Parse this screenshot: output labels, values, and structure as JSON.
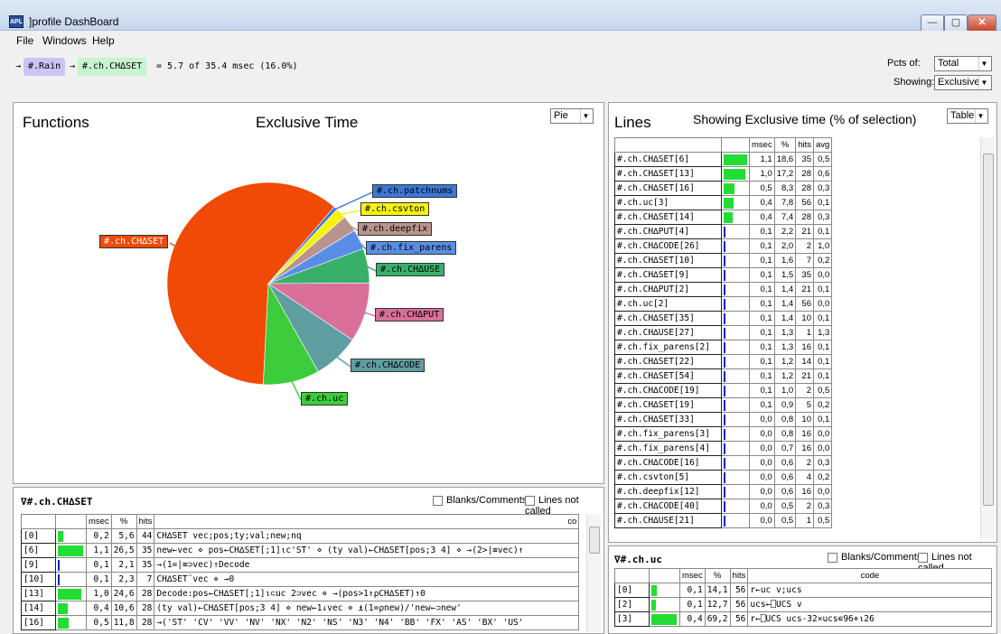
{
  "window": {
    "title": "]profile DashBoard",
    "icon_text": "APL",
    "min": "—",
    "max": "▢",
    "close": "✕"
  },
  "menu": [
    "File",
    "Windows",
    "Help"
  ],
  "selection": {
    "arrow1": "→",
    "tag1": "#.Rain",
    "arrow2": "→",
    "tag2": "#.ch.CH∆SET",
    "summary": "= 5.7 of 35.4 msec (16.0%)"
  },
  "controls": {
    "pcts_label": "Pcts of:",
    "pcts_value": "Total",
    "showing_label": "Showing:",
    "showing_value": "Exclusive"
  },
  "functions": {
    "title": "Functions",
    "subtitle": "Exclusive Time",
    "view": "Pie",
    "pie_labels": [
      "#.ch.CH∆SET",
      "#.ch.patchnums",
      "#.ch.csvton",
      "#.ch.deepfix",
      "#.ch.fix_parens",
      "#.ch.CH∆USE",
      "#.ch.CH∆PUT",
      "#.ch.CH∆CODE",
      "#.ch.uc"
    ]
  },
  "chart_data": {
    "type": "pie",
    "title": "Exclusive Time",
    "slices": [
      {
        "label": "#.ch.CH∆SET",
        "value": 60.5,
        "color": "#f04a06"
      },
      {
        "label": "#.ch.patchnums",
        "value": 0.6,
        "color": "#3a78d6"
      },
      {
        "label": "#.ch.csvton",
        "value": 1.7,
        "color": "#f6f20a"
      },
      {
        "label": "#.ch.deepfix",
        "value": 2.6,
        "color": "#b8948c"
      },
      {
        "label": "#.ch.fix_parens",
        "value": 3.2,
        "color": "#5a8ee6"
      },
      {
        "label": "#.ch.CH∆USE",
        "value": 5.5,
        "color": "#38b06a"
      },
      {
        "label": "#.ch.CH∆PUT",
        "value": 9.5,
        "color": "#d8709a"
      },
      {
        "label": "#.ch.CH∆CODE",
        "value": 7.4,
        "color": "#5f9ea0"
      },
      {
        "label": "#.ch.uc",
        "value": 9.0,
        "color": "#3ccc3c"
      }
    ]
  },
  "lines": {
    "title": "Lines",
    "subtitle": "Showing Exclusive time (% of selection)",
    "view": "Table",
    "headers": [
      "",
      "msec",
      "%",
      "hits",
      "avg"
    ],
    "rows": [
      [
        "#.ch.CH∆SET[6]",
        "1,1",
        "18,6",
        "35",
        "0,5",
        18.6
      ],
      [
        "#.ch.CH∆SET[13]",
        "1,0",
        "17,2",
        "28",
        "0,6",
        17.2
      ],
      [
        "#.ch.CH∆SET[16]",
        "0,5",
        "8,3",
        "28",
        "0,3",
        8.3
      ],
      [
        "#.ch.uc[3]",
        "0,4",
        "7,8",
        "56",
        "0,1",
        7.8
      ],
      [
        "#.ch.CH∆SET[14]",
        "0,4",
        "7,4",
        "28",
        "0,3",
        7.4
      ],
      [
        "#.ch.CH∆PUT[4]",
        "0,1",
        "2,2",
        "21",
        "0,1",
        2.2
      ],
      [
        "#.ch.CH∆CODE[26]",
        "0,1",
        "2,0",
        "2",
        "1,0",
        2.0
      ],
      [
        "#.ch.CH∆SET[10]",
        "0,1",
        "1,6",
        "7",
        "0,2",
        1.6
      ],
      [
        "#.ch.CH∆SET[9]",
        "0,1",
        "1,5",
        "35",
        "0,0",
        1.5
      ],
      [
        "#.ch.CH∆PUT[2]",
        "0,1",
        "1,4",
        "21",
        "0,1",
        1.4
      ],
      [
        "#.ch.uc[2]",
        "0,1",
        "1,4",
        "56",
        "0,0",
        1.4
      ],
      [
        "#.ch.CH∆SET[35]",
        "0,1",
        "1,4",
        "10",
        "0,1",
        1.4
      ],
      [
        "#.ch.CH∆USE[27]",
        "0,1",
        "1,3",
        "1",
        "1,3",
        1.3
      ],
      [
        "#.ch.fix_parens[2]",
        "0,1",
        "1,3",
        "16",
        "0,1",
        1.3
      ],
      [
        "#.ch.CH∆SET[22]",
        "0,1",
        "1,2",
        "14",
        "0,1",
        1.2
      ],
      [
        "#.ch.CH∆SET[54]",
        "0,1",
        "1,2",
        "21",
        "0,1",
        1.2
      ],
      [
        "#.ch.CH∆CODE[19]",
        "0,1",
        "1,0",
        "2",
        "0,5",
        1.0
      ],
      [
        "#.ch.CH∆SET[19]",
        "0,1",
        "0,9",
        "5",
        "0,2",
        0.9
      ],
      [
        "#.ch.CH∆SET[33]",
        "0,0",
        "0,8",
        "10",
        "0,1",
        0.8
      ],
      [
        "#.ch.fix_parens[3]",
        "0,0",
        "0,8",
        "16",
        "0,0",
        0.8
      ],
      [
        "#.ch.fix_parens[4]",
        "0,0",
        "0,7",
        "16",
        "0,0",
        0.7
      ],
      [
        "#.ch.CH∆CODE[16]",
        "0,0",
        "0,6",
        "2",
        "0,3",
        0.6
      ],
      [
        "#.ch.csvton[5]",
        "0,0",
        "0,6",
        "4",
        "0,2",
        0.6
      ],
      [
        "#.ch.deepfix[12]",
        "0,0",
        "0,6",
        "16",
        "0,0",
        0.6
      ],
      [
        "#.ch.CH∆CODE[40]",
        "0,0",
        "0,5",
        "2",
        "0,3",
        0.5
      ],
      [
        "#.ch.CH∆USE[21]",
        "0,0",
        "0,5",
        "1",
        "0,5",
        0.5
      ]
    ]
  },
  "code1": {
    "title": "∇#.ch.CH∆SET",
    "blanks": "Blanks/Comments",
    "notcalled": "Lines not called",
    "headers": [
      "",
      "msec",
      "%",
      "hits",
      "co"
    ],
    "rows": [
      [
        "[0]",
        "0,2",
        "5,6",
        "44",
        "CH∆SET vec;pos;ty;val;new;nq",
        5.6
      ],
      [
        "[6]",
        "1,1",
        "26,5",
        "35",
        "new←vec ⋄ pos←CH∆SET[;1]⍳c'ST' ⋄ (ty val)←CH∆SET[pos;3 4] ⋄ →(2>|≡vec)↑",
        26.5
      ],
      [
        "[9]",
        "0,1",
        "2,1",
        "35",
        "→(1=|≡⊃vec)↑Decode",
        2.1
      ],
      [
        "[10]",
        "0,1",
        "2,3",
        "7",
        "CH∆SET¨vec ⋄ →0",
        2.3
      ],
      [
        "[13]",
        "1,0",
        "24,6",
        "28",
        "Decode:pos←CH∆SET[;1]⍳⊂uc 2⊃vec ⋄ →(pos>1↑⍴CH∆SET)↑0",
        24.6
      ],
      [
        "[14]",
        "0,4",
        "10,6",
        "28",
        "(ty val)←CH∆SET[pos;3 4] ⋄ new←1↓vec ⋄ ⍎(1=⍴new)/'new←⊃new'",
        10.6
      ],
      [
        "[16]",
        "0,5",
        "11,8",
        "28",
        "→('ST' 'CV' 'VV' 'NV' 'NX' 'N2' 'NS' 'N3' 'N4' 'BB' 'FX' 'AS' 'BX' 'US'",
        11.8
      ]
    ]
  },
  "code2": {
    "title": "∇#.ch.uc",
    "blanks": "Blanks/Comments",
    "notcalled": "Lines not called",
    "headers": [
      "",
      "msec",
      "%",
      "hits",
      "code"
    ],
    "rows": [
      [
        "[0]",
        "0,1",
        "14,1",
        "56",
        "r←uc v;ucs",
        14.1
      ],
      [
        "[2]",
        "0,1",
        "12,7",
        "56",
        "ucs←⎕UCS v",
        12.7
      ],
      [
        "[3]",
        "0,4",
        "69,2",
        "56",
        "r←⎕UCS ucs-32×ucs∊96+⍳26",
        69.2
      ]
    ]
  }
}
